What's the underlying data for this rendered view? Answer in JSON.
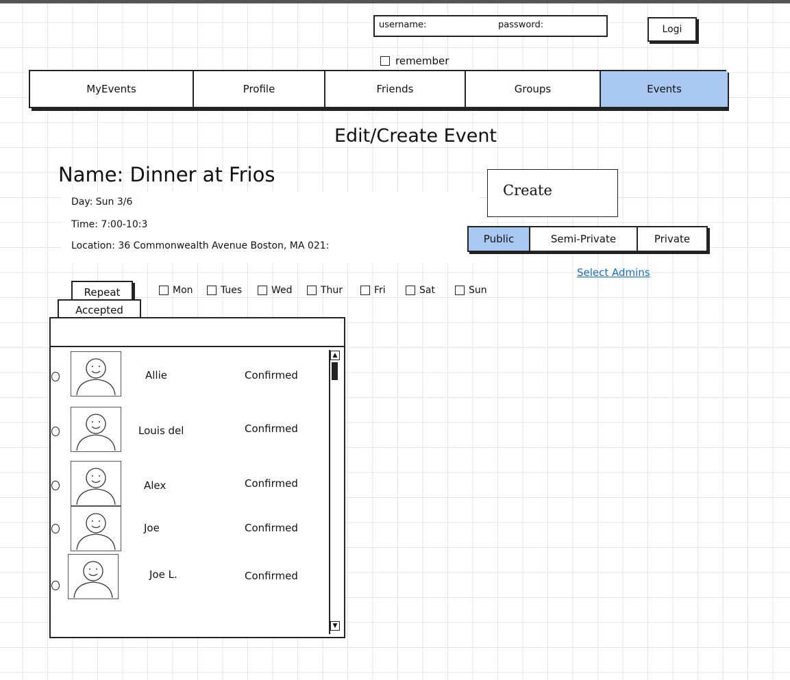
{
  "login": {
    "username_label": "username:",
    "password_label": "password:",
    "login_button": "Logi",
    "remember_label": "remember"
  },
  "nav": {
    "tabs": [
      {
        "label": "MyEvents",
        "active": false
      },
      {
        "label": "Profile",
        "active": false
      },
      {
        "label": "Friends",
        "active": false
      },
      {
        "label": "Groups",
        "active": false
      },
      {
        "label": "Events",
        "active": true
      }
    ]
  },
  "page": {
    "title": "Edit/Create Event"
  },
  "event": {
    "name_line": "Name: Dinner at Frios",
    "day_line": "Day: Sun 3/6",
    "time_line": "Time: 7:00-10:3",
    "location_line": "Location: 36 Commonwealth Avenue Boston, MA 021:"
  },
  "actions": {
    "create_label": "Create",
    "repeat_label": "Repeat",
    "select_admins_label": "Select Admins"
  },
  "privacy": {
    "options": [
      {
        "label": "Public",
        "active": true
      },
      {
        "label": "Semi-Private",
        "active": false
      },
      {
        "label": "Private",
        "active": false
      }
    ]
  },
  "days": [
    "Mon",
    "Tues",
    "Wed",
    "Thur",
    "Fri",
    "Sat",
    "Sun"
  ],
  "accepted": {
    "tab_label": "Accepted",
    "rows": [
      {
        "name": "Allie",
        "status": "Confirmed"
      },
      {
        "name": "Louis del",
        "status": "Confirmed"
      },
      {
        "name": "Alex",
        "status": "Confirmed"
      },
      {
        "name": "Joe",
        "status": "Confirmed"
      },
      {
        "name": "Joe L.",
        "status": "Confirmed"
      }
    ]
  },
  "colors": {
    "active_tab": "#a9c9f2",
    "link": "#1a6bc7",
    "grid": "#e4e4e4"
  },
  "icons": [
    "avatar-icon",
    "checkbox-icon",
    "radio-icon",
    "scroll-up-arrow-icon",
    "scroll-down-arrow-icon"
  ]
}
